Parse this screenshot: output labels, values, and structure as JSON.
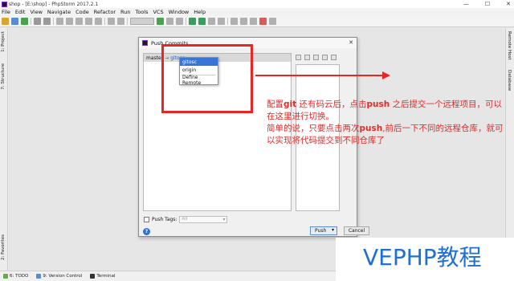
{
  "window": {
    "title": "shop - [E:\\shop] - PhpStorm 2017.2.1",
    "controls": [
      "—",
      "☐",
      "✕"
    ]
  },
  "menu": [
    "File",
    "Edit",
    "View",
    "Navigate",
    "Code",
    "Refactor",
    "Run",
    "Tools",
    "VCS",
    "Window",
    "Help"
  ],
  "left_tabs": [
    "1: Project",
    "7: Structure",
    "2: Favorites"
  ],
  "right_tabs": [
    "Remote Host",
    "Database"
  ],
  "bottom_tabs": [
    {
      "label": "6: TODO",
      "icon": "todo-icon"
    },
    {
      "label": "9: Version Control",
      "icon": "version-control-icon"
    },
    {
      "label": "Terminal",
      "icon": "terminal-icon"
    }
  ],
  "dialog": {
    "title": "Push Commits",
    "branch": "master",
    "arrow": "→",
    "remote": "gitosc",
    "remote_menu": {
      "items": [
        "gitosc",
        "origin"
      ],
      "selected": "gitosc",
      "action": "Define Remote"
    },
    "push_tags_label": "Push Tags:",
    "push_tags_value": "All",
    "push_button": "Push",
    "push_dropdown": "▾",
    "cancel_button": "Cancel",
    "help": "?"
  },
  "annotation": {
    "line1_prefix": "配置",
    "line1_git": "git",
    "line1_mid": " 还有码云后，点击",
    "line1_push": "push",
    "line1_suffix": " 之后提交一个远程项目，可以在这里进行切换。",
    "line2_prefix": "简单的说，只要点击两次",
    "line2_push": "push",
    "line2_suffix": ",前后一下不同的远程仓库，就可以实现将代码提交到不同仓库了"
  },
  "watermark": "VEPHP教程",
  "colors": {
    "annotation": "#e22a2a",
    "watermark": "#1e6fd6",
    "selection": "#3875d7",
    "remote_link": "#1d5fd1"
  }
}
